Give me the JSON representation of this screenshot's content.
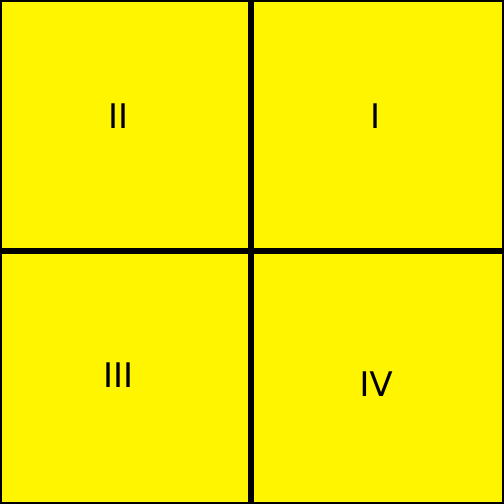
{
  "colors": {
    "fill": "#fff500",
    "border": "#000000",
    "text": "#000000"
  },
  "quadrants": {
    "top_left": {
      "label": "II"
    },
    "top_right": {
      "label": "I"
    },
    "bottom_left": {
      "label": "III"
    },
    "bottom_right": {
      "label": "IV"
    }
  }
}
